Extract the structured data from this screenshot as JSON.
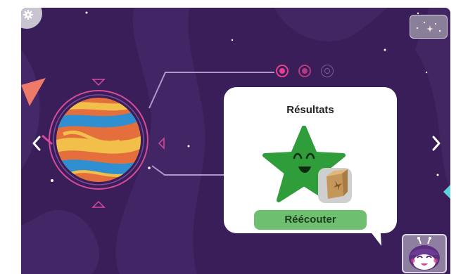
{
  "results": {
    "title": "Résultats",
    "replay_label": "Réécouter"
  },
  "progress": {
    "total_dots": 3,
    "active_index": 1
  },
  "icons": {
    "settings": "gear-icon",
    "map": "star-map-icon",
    "left": "chevron-left-icon",
    "right": "chevron-right-icon",
    "planet": "striped-planet-icon",
    "star": "smiling-star-icon",
    "badge": "cardboard-box-icon",
    "avatar": "robot-mascot-icon"
  },
  "colors": {
    "background": "#3a1e59",
    "accent_pink": "#e6418f",
    "star_green": "#2f9e3a",
    "button_green": "#6fbf70"
  }
}
